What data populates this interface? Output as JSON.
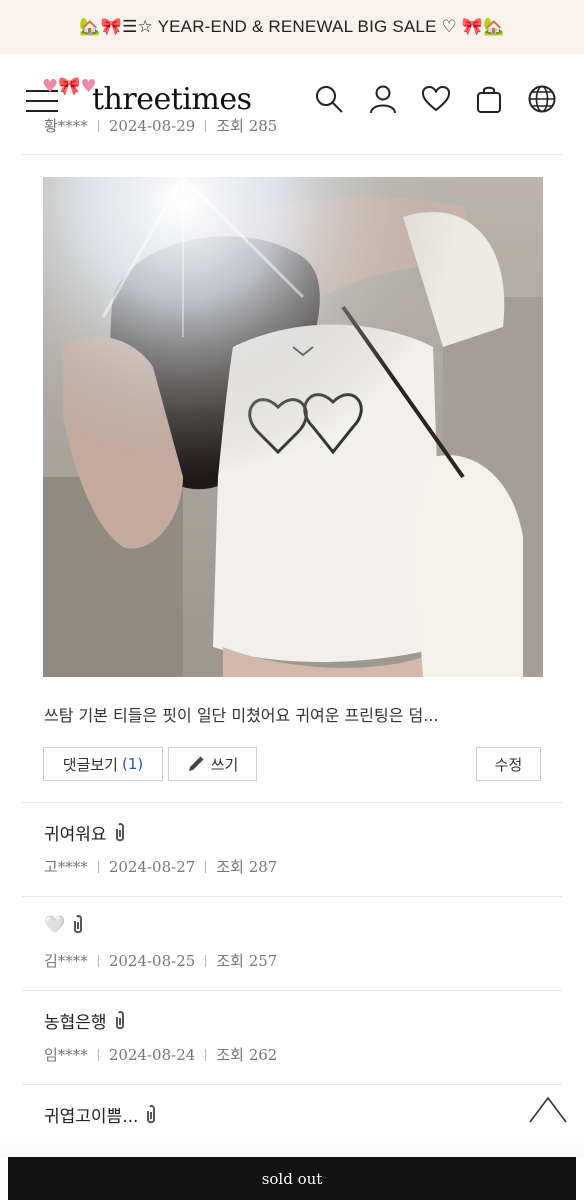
{
  "banner": {
    "text": "🏡🎀☰☆ YEAR-END & RENEWAL BIG SALE ♡ 🎀🏡"
  },
  "header": {
    "logo": "threetimes",
    "icons": [
      "search-icon",
      "user-icon",
      "heart-icon",
      "bag-icon",
      "globe-icon"
    ]
  },
  "posts": [
    {
      "author": "황****",
      "date": "2024-08-29",
      "views_label": "조회",
      "views": "285"
    }
  ],
  "featured": {
    "excerpt": "쓰탐 기본 티들은 핏이 일단 미쳤어요 귀여운 프린팅은 덤...",
    "comments_label": "댓글보기",
    "comments_count": "(1)",
    "write_label": "쓰기",
    "edit_label": "수정"
  },
  "reviews": [
    {
      "title": "귀여워요",
      "author": "고****",
      "date": "2024-08-27",
      "views_label": "조회",
      "views": "287"
    },
    {
      "title": "🤍",
      "author": "김****",
      "date": "2024-08-25",
      "views_label": "조회",
      "views": "257"
    },
    {
      "title": "농협은행",
      "author": "임****",
      "date": "2024-08-24",
      "views_label": "조회",
      "views": "262"
    },
    {
      "title": "귀엽고이쁨...",
      "author": "",
      "date": "",
      "views_label": "",
      "views": ""
    }
  ],
  "bottom_bar": {
    "label": "sold out"
  },
  "colors": {
    "banner_bg": "#f7f3ec",
    "bottom_bar": "#121212",
    "link_count": "#2a56b5"
  }
}
